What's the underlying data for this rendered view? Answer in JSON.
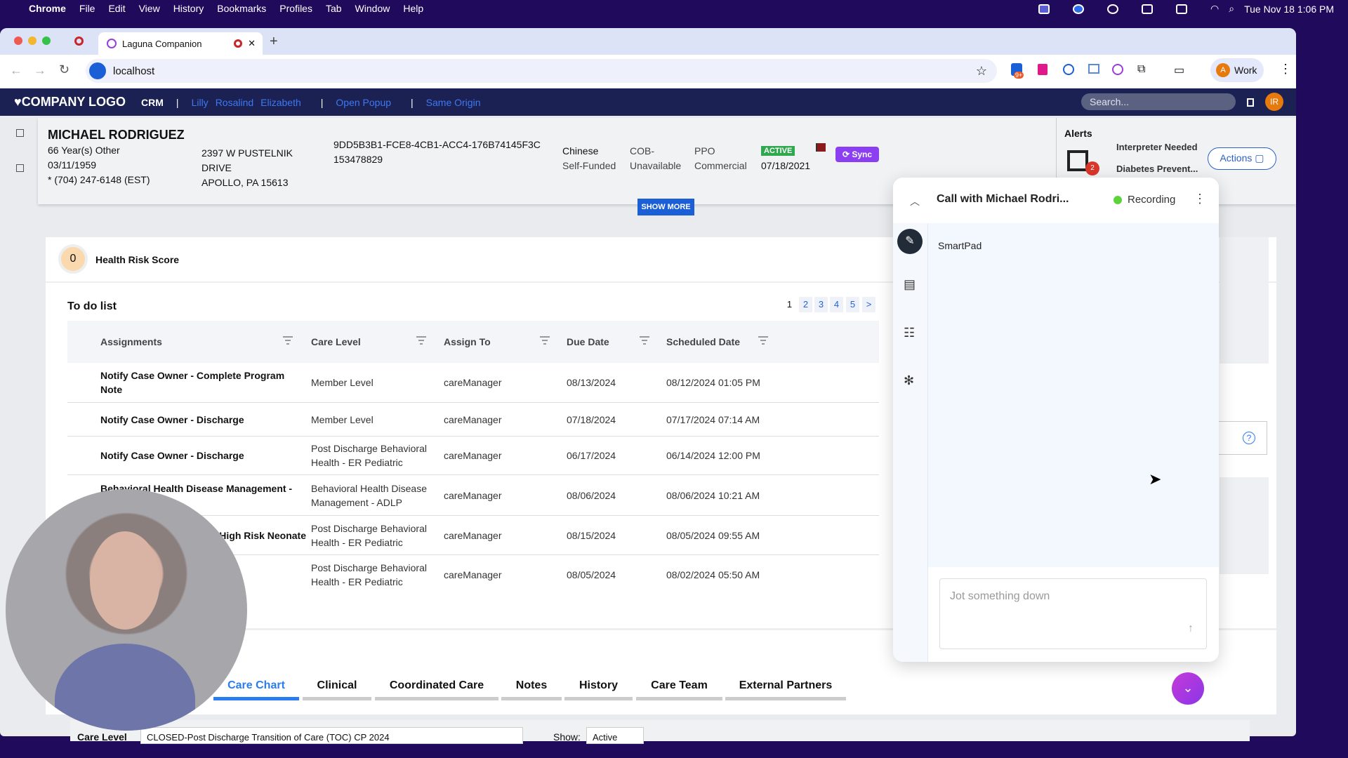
{
  "os_menubar": {
    "app": "Chrome",
    "items": [
      "File",
      "Edit",
      "View",
      "History",
      "Bookmarks",
      "Profiles",
      "Tab",
      "Window",
      "Help"
    ],
    "clock": "Tue Nov 18  1:06 PM"
  },
  "browser": {
    "tab_title": "Laguna Companion",
    "url": "localhost",
    "profile": "Work",
    "profile_initial": "A",
    "ext_badge": "9+"
  },
  "navbar": {
    "logo": "COMPANY LOGO",
    "crm": "CRM",
    "links": [
      "Lilly",
      "Rosalind",
      "Elizabeth"
    ],
    "open_popup": "Open Popup",
    "same_origin": "Same Origin",
    "search_placeholder": "Search...",
    "avatar": "IR"
  },
  "patient": {
    "name": "MICHAEL RODRIGUEZ",
    "age_gender": "66 Year(s) Other",
    "dob": "03/11/1959",
    "phone": "* (704) 247-6148  (EST)",
    "address1": "2397 W PUSTELNIK",
    "address2": "DRIVE",
    "address3": "APOLLO, PA 15613",
    "uuid": "9DD5B3B1-FCE8-4CB1-ACC4-176B74145F3C",
    "member_id": "153478829",
    "language": "Chinese",
    "funding": "Self-Funded",
    "cob1": "COB-",
    "cob2": "Unavailable",
    "plan1": "PPO",
    "plan2": "Commercial",
    "status": "ACTIVE",
    "status_date": "07/18/2021",
    "sync": "Sync",
    "show_more": "SHOW MORE"
  },
  "alerts": {
    "title": "Alerts",
    "count": "2",
    "items": [
      "Interpreter Needed",
      "Diabetes Prevent..."
    ],
    "actions": "Actions"
  },
  "health_risk": {
    "score": "0",
    "label": "Health Risk Score"
  },
  "todo": {
    "title": "To do list",
    "pages": [
      "1",
      "2",
      "3",
      "4",
      "5",
      ">"
    ],
    "columns": [
      "Assignments",
      "Care Level",
      "Assign To",
      "Due Date",
      "Scheduled Date"
    ],
    "rows": [
      {
        "assignment": "Notify Case Owner - Complete Program Note",
        "care_level": "Member Level",
        "assign_to": "careManager",
        "due": "08/13/2024",
        "scheduled": "08/12/2024 01:05 PM"
      },
      {
        "assignment": "Notify Case Owner - Discharge",
        "care_level": "Member Level",
        "assign_to": "careManager",
        "due": "07/18/2024",
        "scheduled": "07/17/2024 07:14 AM"
      },
      {
        "assignment": "Notify Case Owner - Discharge",
        "care_level": "Post Discharge Behavioral Health - ER Pediatric",
        "assign_to": "careManager",
        "due": "06/17/2024",
        "scheduled": "06/14/2024 12:00 PM"
      },
      {
        "assignment": "Behavioral Health Disease Management - ...ber",
        "care_level": "Behavioral Health Disease Management - ADLP",
        "assign_to": "careManager",
        "due": "08/06/2024",
        "scheduled": "08/06/2024 10:21 AM"
      },
      {
        "assignment": "...High Risk Neonate",
        "care_level": "Post Discharge Behavioral Health - ER Pediatric",
        "assign_to": "careManager",
        "due": "08/15/2024",
        "scheduled": "08/05/2024 09:55 AM"
      },
      {
        "assignment": "",
        "care_level": "Post Discharge Behavioral Health - ER Pediatric",
        "assign_to": "careManager",
        "due": "08/05/2024",
        "scheduled": "08/02/2024 05:50 AM"
      }
    ]
  },
  "tabs": [
    "Care Chart",
    "Clinical",
    "Coordinated Care",
    "Notes",
    "History",
    "Care Team",
    "External Partners"
  ],
  "bottom": {
    "care_level_label": "Care Level",
    "care_level_value": "CLOSED-Post Discharge Transition of Care (TOC) CP 2024",
    "show_label": "Show:",
    "show_value": "Active"
  },
  "panel": {
    "title": "Call with Michael Rodri...",
    "recording": "Recording",
    "section": "SmartPad",
    "placeholder": "Jot something down"
  },
  "colors": {
    "navbar": "#1b2153",
    "accent": "#1a5fd6",
    "active": "#2fa84f",
    "sync": "#8b3ff0",
    "recording": "#5cd33a"
  }
}
